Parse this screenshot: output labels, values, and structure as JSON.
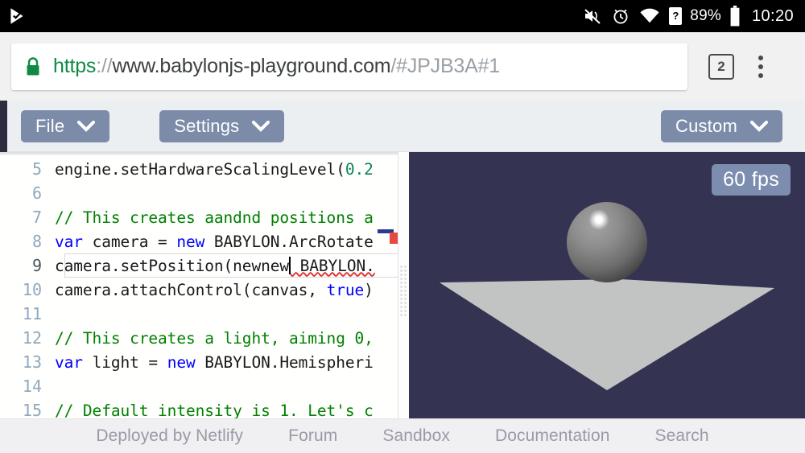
{
  "status_bar": {
    "notification_icon": "play-check-icon",
    "icons": [
      "volume-mute-icon",
      "alarm-clock-icon",
      "wifi-icon",
      "sim-unknown-icon",
      "battery-icon"
    ],
    "sim_label": "?",
    "battery_percent": "89%",
    "time": "10:20"
  },
  "browser": {
    "lock_icon": "lock-icon",
    "url_scheme": "https",
    "url_separator": "://",
    "url_host": "www.babylonjs-playground.com",
    "url_path": "/#JPJB3A#1",
    "tab_count": "2",
    "menu_icon": "kebab-menu-icon"
  },
  "toolbar": {
    "file_label": "File",
    "settings_label": "Settings",
    "custom_label": "Custom",
    "dropdown_icon": "chevron-down-icon",
    "button_color": "#7b8ba8"
  },
  "editor": {
    "lines": [
      {
        "n": "5",
        "active": false,
        "segments": [
          {
            "t": "engine.setHardwareScalingLevel(",
            "c": "plain"
          },
          {
            "t": "0.2",
            "c": "num"
          }
        ]
      },
      {
        "n": "6",
        "active": false,
        "segments": []
      },
      {
        "n": "7",
        "active": false,
        "segments": [
          {
            "t": "// This creates aandnd positions a",
            "c": "cm"
          }
        ]
      },
      {
        "n": "8",
        "active": false,
        "segments": [
          {
            "t": "var ",
            "c": "kw"
          },
          {
            "t": "camera = ",
            "c": "plain"
          },
          {
            "t": "new ",
            "c": "kw"
          },
          {
            "t": "BABYLON.ArcRotate",
            "c": "plain"
          }
        ]
      },
      {
        "n": "9",
        "active": true,
        "segments": [
          {
            "t": "camera.setPosition(newnew",
            "c": "plain"
          },
          {
            "t": "|",
            "c": "caret"
          },
          {
            "t": " BABYLON.",
            "c": "squiggle"
          }
        ]
      },
      {
        "n": "10",
        "active": false,
        "segments": [
          {
            "t": "camera.attachControl(canvas, ",
            "c": "plain"
          },
          {
            "t": "true",
            "c": "kw"
          },
          {
            "t": ")",
            "c": "plain"
          }
        ]
      },
      {
        "n": "11",
        "active": false,
        "segments": []
      },
      {
        "n": "12",
        "active": false,
        "segments": [
          {
            "t": "// This creates a light, aiming 0,",
            "c": "cm"
          }
        ]
      },
      {
        "n": "13",
        "active": false,
        "segments": [
          {
            "t": "var ",
            "c": "kw"
          },
          {
            "t": "light = ",
            "c": "plain"
          },
          {
            "t": "new ",
            "c": "kw"
          },
          {
            "t": "BABYLON.Hemispheri",
            "c": "plain"
          }
        ]
      },
      {
        "n": "14",
        "active": false,
        "segments": []
      },
      {
        "n": "15",
        "active": false,
        "segments": [
          {
            "t": "// Default intensity is 1. Let's c",
            "c": "cm"
          }
        ]
      }
    ],
    "comment_color": "#008000",
    "keyword_color": "#0000ff",
    "number_color": "#098658",
    "error_marker_color": "#e8493f"
  },
  "canvas": {
    "fps_label": "60 fps",
    "background_color": "#343452",
    "ground_color": "#c2c4c4",
    "sphere_color": "#6c6c6c"
  },
  "footer": {
    "links": [
      {
        "label": "Deployed by Netlify"
      },
      {
        "label": "Forum"
      },
      {
        "label": "Sandbox"
      },
      {
        "label": "Documentation"
      },
      {
        "label": "Search"
      }
    ]
  }
}
